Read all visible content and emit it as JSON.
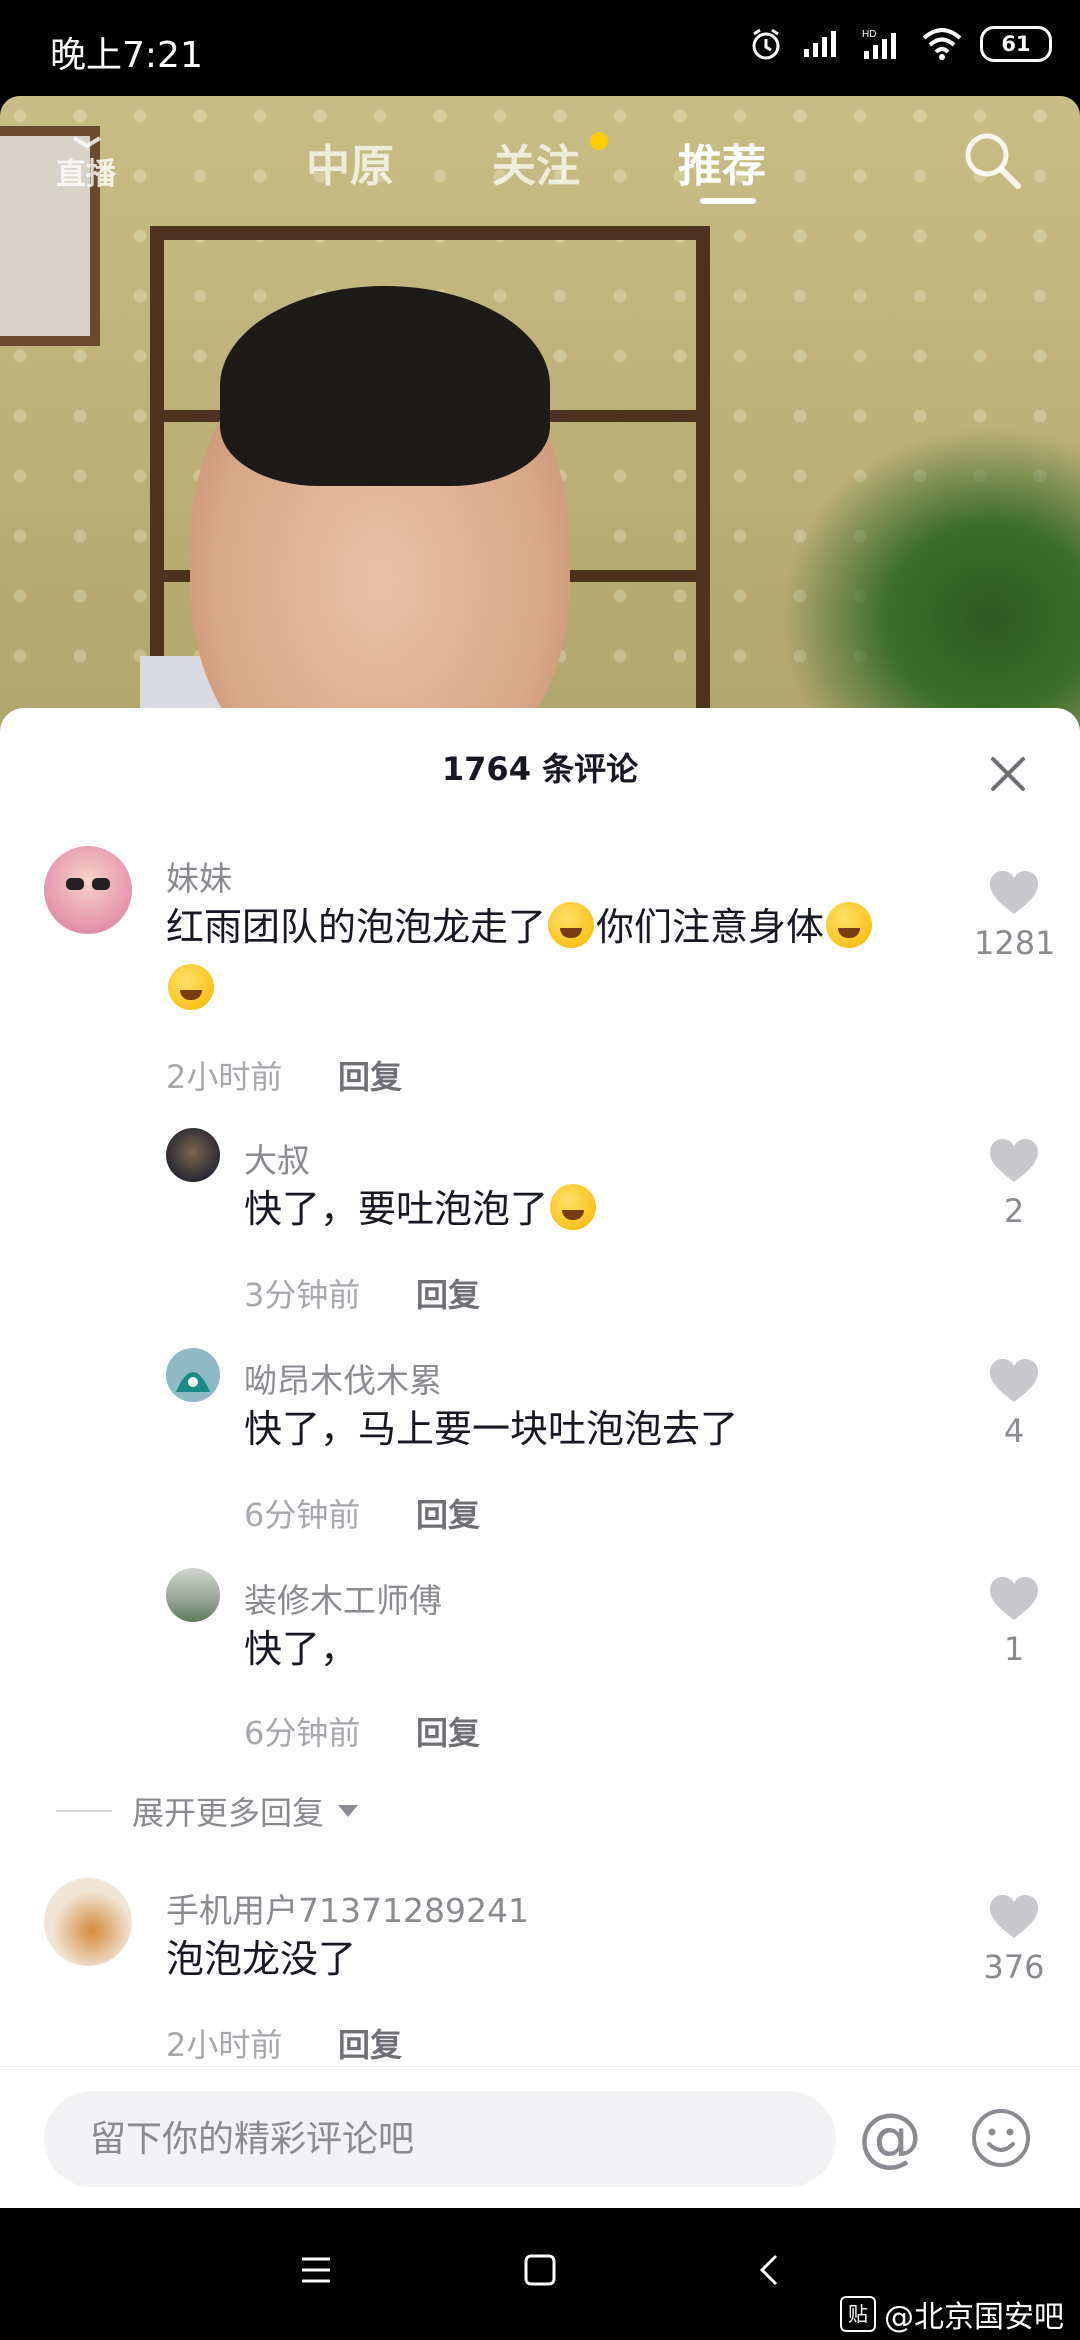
{
  "status_bar": {
    "time": "晚上7:21",
    "battery": "61"
  },
  "top_nav": {
    "live_label": "直播",
    "tabs": [
      {
        "label": "中原"
      },
      {
        "label": "关注"
      },
      {
        "label": "推荐"
      }
    ]
  },
  "comments_sheet": {
    "title": "1764 条评论",
    "comments": [
      {
        "user": "妹妹",
        "text": "红雨团队的泡泡龙走了",
        "text2": "你们注意身体",
        "time": "2小时前",
        "reply": "回复",
        "likes": "1281"
      },
      {
        "user": "大叔",
        "text": "快了，要吐泡泡了",
        "time": "3分钟前",
        "reply": "回复",
        "likes": "2"
      },
      {
        "user": "呦昂木伐木累",
        "text": "快了，马上要一块吐泡泡去了",
        "time": "6分钟前",
        "reply": "回复",
        "likes": "4"
      },
      {
        "user": "装修木工师傅",
        "text": "快了，",
        "time": "6分钟前",
        "reply": "回复",
        "likes": "1"
      },
      {
        "user": "手机用户71371289241",
        "text": "泡泡龙没了",
        "time": "2小时前",
        "reply": "回复",
        "likes": "376"
      }
    ],
    "expand_more": "展开更多回复"
  },
  "input_bar": {
    "placeholder": "留下你的精彩评论吧",
    "at": "@"
  },
  "watermark": {
    "badge": "贴",
    "text": "@北京国安吧"
  },
  "colors": {
    "accent_dot": "#ffcc00",
    "text_primary": "#161823",
    "text_secondary": "#8a8b91"
  }
}
